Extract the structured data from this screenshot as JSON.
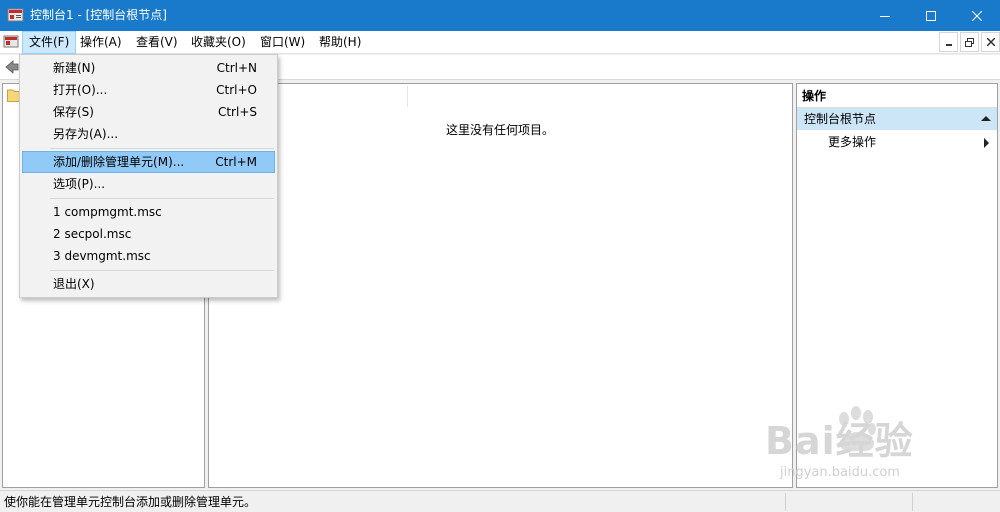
{
  "window": {
    "title": "控制台1 - [控制台根节点]"
  },
  "menubar": {
    "items": [
      "文件(F)",
      "操作(A)",
      "查看(V)",
      "收藏夹(O)",
      "窗口(W)",
      "帮助(H)"
    ]
  },
  "file_menu": {
    "items": [
      {
        "label": "新建(N)",
        "shortcut": "Ctrl+N"
      },
      {
        "label": "打开(O)...",
        "shortcut": "Ctrl+O"
      },
      {
        "label": "保存(S)",
        "shortcut": "Ctrl+S"
      },
      {
        "label": "另存为(A)...",
        "shortcut": ""
      },
      {
        "label": "添加/删除管理单元(M)...",
        "shortcut": "Ctrl+M"
      },
      {
        "label": "选项(P)...",
        "shortcut": ""
      },
      {
        "label": "1 compmgmt.msc",
        "shortcut": ""
      },
      {
        "label": "2 secpol.msc",
        "shortcut": ""
      },
      {
        "label": "3 devmgmt.msc",
        "shortcut": ""
      },
      {
        "label": "退出(X)",
        "shortcut": ""
      }
    ],
    "highlighted_index": 4
  },
  "center": {
    "empty_message": "这里没有任何项目。"
  },
  "actions": {
    "header": "操作",
    "section": "控制台根节点",
    "more": "更多操作"
  },
  "statusbar": {
    "text": "使你能在管理单元控制台添加或删除管理单元。"
  },
  "watermark": {
    "brand": "Bai经验",
    "url": "jingyan.baidu.com"
  },
  "colors": {
    "titlebar": "#1979ca",
    "menu_highlight": "#91c9f7",
    "actions_section": "#cde6f7"
  }
}
